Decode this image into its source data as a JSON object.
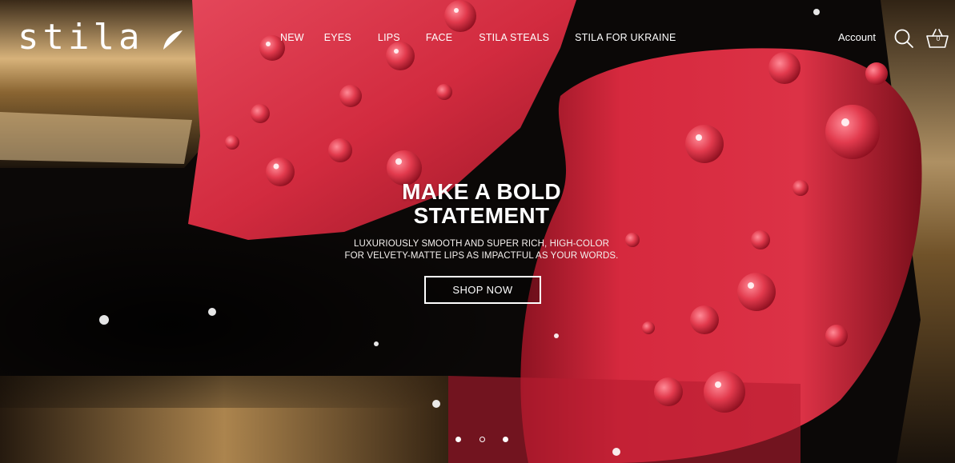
{
  "brand": {
    "logo_text": "stila"
  },
  "nav": {
    "items": [
      "NEW",
      "EYES",
      "LIPS",
      "FACE",
      "STILA STEALS",
      "STILA FOR UKRAINE"
    ]
  },
  "header": {
    "account_label": "Account",
    "basket_count": "0",
    "icons": [
      "search-icon",
      "basket-icon"
    ]
  },
  "hero": {
    "headline_line1": "MAKE A BOLD",
    "headline_line2": "STATEMENT",
    "subtext_line1": "LUXURIOUSLY SMOOTH AND SUPER RICH, HIGH-COLOR",
    "subtext_line2": "FOR VELVETY-MATTE LIPS AS IMPACTFUL AS YOUR WORDS.",
    "cta_label": "SHOP NOW",
    "image_subject": "red lipstick bullets with water droplets on gold tubes",
    "colors": {
      "lipstick_red": "#d3263a",
      "gold": "#b8894a",
      "background": "#0b0807"
    }
  },
  "carousel": {
    "slide_count": 3,
    "active_index": 1
  }
}
